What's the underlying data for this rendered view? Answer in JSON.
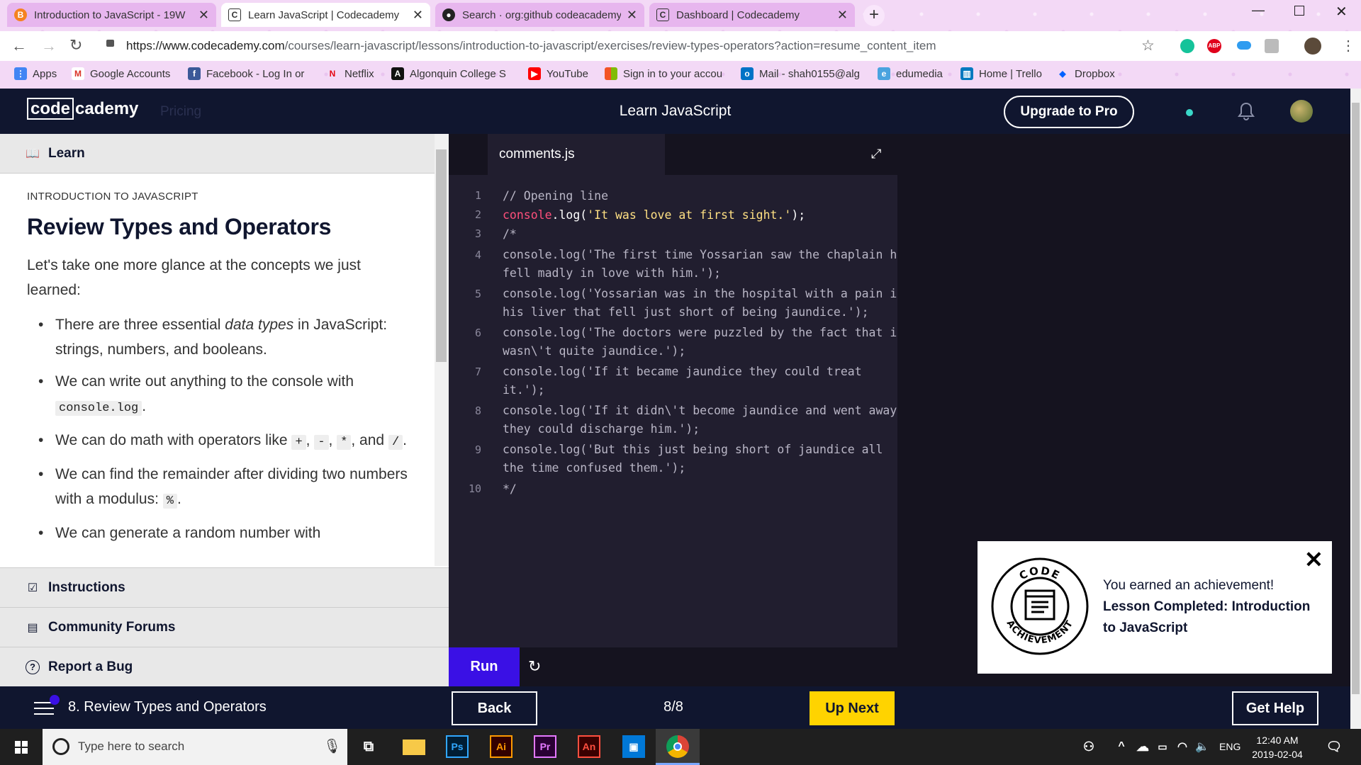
{
  "browser": {
    "tabs": [
      {
        "title": "Introduction to JavaScript - 19W",
        "icon": "brightspace-icon",
        "active": false
      },
      {
        "title": "Learn JavaScript | Codecademy",
        "icon": "codecademy-icon",
        "active": true
      },
      {
        "title": "Search · org:github codeacademy",
        "icon": "github-icon",
        "active": false
      },
      {
        "title": "Dashboard | Codecademy",
        "icon": "codecademy-icon",
        "active": false
      }
    ],
    "url_host": "https://www.codecademy.com",
    "url_path": "/courses/learn-javascript/lessons/introduction-to-javascript/exercises/review-types-operators?action=resume_content_item",
    "bookmarks": [
      {
        "label": "Apps",
        "icon": "apps-grid-icon"
      },
      {
        "label": "Google Accounts",
        "icon": "gmail-icon"
      },
      {
        "label": "Facebook - Log In or",
        "icon": "facebook-icon"
      },
      {
        "label": "Netflix",
        "icon": "netflix-icon"
      },
      {
        "label": "Algonquin College S",
        "icon": "algonquin-icon"
      },
      {
        "label": "YouTube",
        "icon": "youtube-icon"
      },
      {
        "label": "Sign in to your accou",
        "icon": "microsoft-icon"
      },
      {
        "label": "Mail - shah0155@alg",
        "icon": "outlook-icon"
      },
      {
        "label": "edumedia",
        "icon": "edumedia-icon"
      },
      {
        "label": "Home | Trello",
        "icon": "trello-icon"
      },
      {
        "label": "Dropbox",
        "icon": "dropbox-icon"
      }
    ]
  },
  "header": {
    "logo_left": "code",
    "logo_right": "cademy",
    "pricing": "Pricing",
    "title": "Learn JavaScript",
    "upgrade": "Upgrade to Pro"
  },
  "left": {
    "learn_tab": "Learn",
    "breadcrumb": "INTRODUCTION TO JAVASCRIPT",
    "title": "Review Types and Operators",
    "intro": "Let's take one more glance at the concepts we just learned:",
    "points": {
      "p1_a": "There are three essential ",
      "p1_em": "data types",
      "p1_b": " in JavaScript: strings, numbers, and booleans.",
      "p2_a": "We can write out anything to the console with ",
      "p2_code": "console.log",
      "p2_b": ".",
      "p3_a": "We can do math with operators like ",
      "p3_plus": "+",
      "p3_minus": "-",
      "p3_times": "*",
      "p3_and": ", and",
      "p3_div": "/",
      "p3_b": ".",
      "p4_a": "We can find the remainder after dividing two numbers with a modulus: ",
      "p4_code": "%",
      "p4_b": ".",
      "p5_a": "We can generate a random number with"
    },
    "nav": {
      "instructions": "Instructions",
      "forums": "Community Forums",
      "bug": "Report a Bug"
    }
  },
  "editor": {
    "filename": "comments.js",
    "run": "Run",
    "lines": [
      {
        "n": "1",
        "text": "// Opening line"
      },
      {
        "n": "2",
        "text": "console.log('It was love at first sight.');"
      },
      {
        "n": "3",
        "text": "/*"
      },
      {
        "n": "4",
        "text": "console.log('The first time Yossarian saw the chaplain he\nfell madly in love with him.');"
      },
      {
        "n": "5",
        "text": "console.log('Yossarian was in the hospital with a pain in\nhis liver that fell just short of being jaundice.');"
      },
      {
        "n": "6",
        "text": "console.log('The doctors were puzzled by the fact that it\nwasn\\'t quite jaundice.');"
      },
      {
        "n": "7",
        "text": "console.log('If it became jaundice they could treat\nit.');"
      },
      {
        "n": "8",
        "text": "console.log('If it didn\\'t become jaundice and went away\nthey could discharge him.');"
      },
      {
        "n": "9",
        "text": "console.log('But this just being short of jaundice all\nthe time confused them.');"
      },
      {
        "n": "10",
        "text": "*/"
      }
    ],
    "line2": {
      "kw": "console",
      "dot": ".log(",
      "str": "'It was love at first sight.'",
      "end": ");"
    }
  },
  "achievement": {
    "line1": "You earned an achievement!",
    "line2": "Lesson Completed: Introduction to JavaScript",
    "badge_top": "CODE",
    "badge_bottom": "ACHIEVEMENT"
  },
  "footer": {
    "exercise": "8. Review Types and Operators",
    "back": "Back",
    "progress": "8/8",
    "next": "Up Next",
    "help": "Get Help"
  },
  "taskbar": {
    "search_placeholder": "Type here to search",
    "lang": "ENG",
    "time": "12:40 AM",
    "date": "2019-02-04"
  },
  "colors": {
    "brand_navy": "#10162f",
    "run_purple": "#3a10e5",
    "next_yellow": "#ffd300",
    "code_keyword": "#ff4f7b",
    "code_string": "#ffe083"
  }
}
